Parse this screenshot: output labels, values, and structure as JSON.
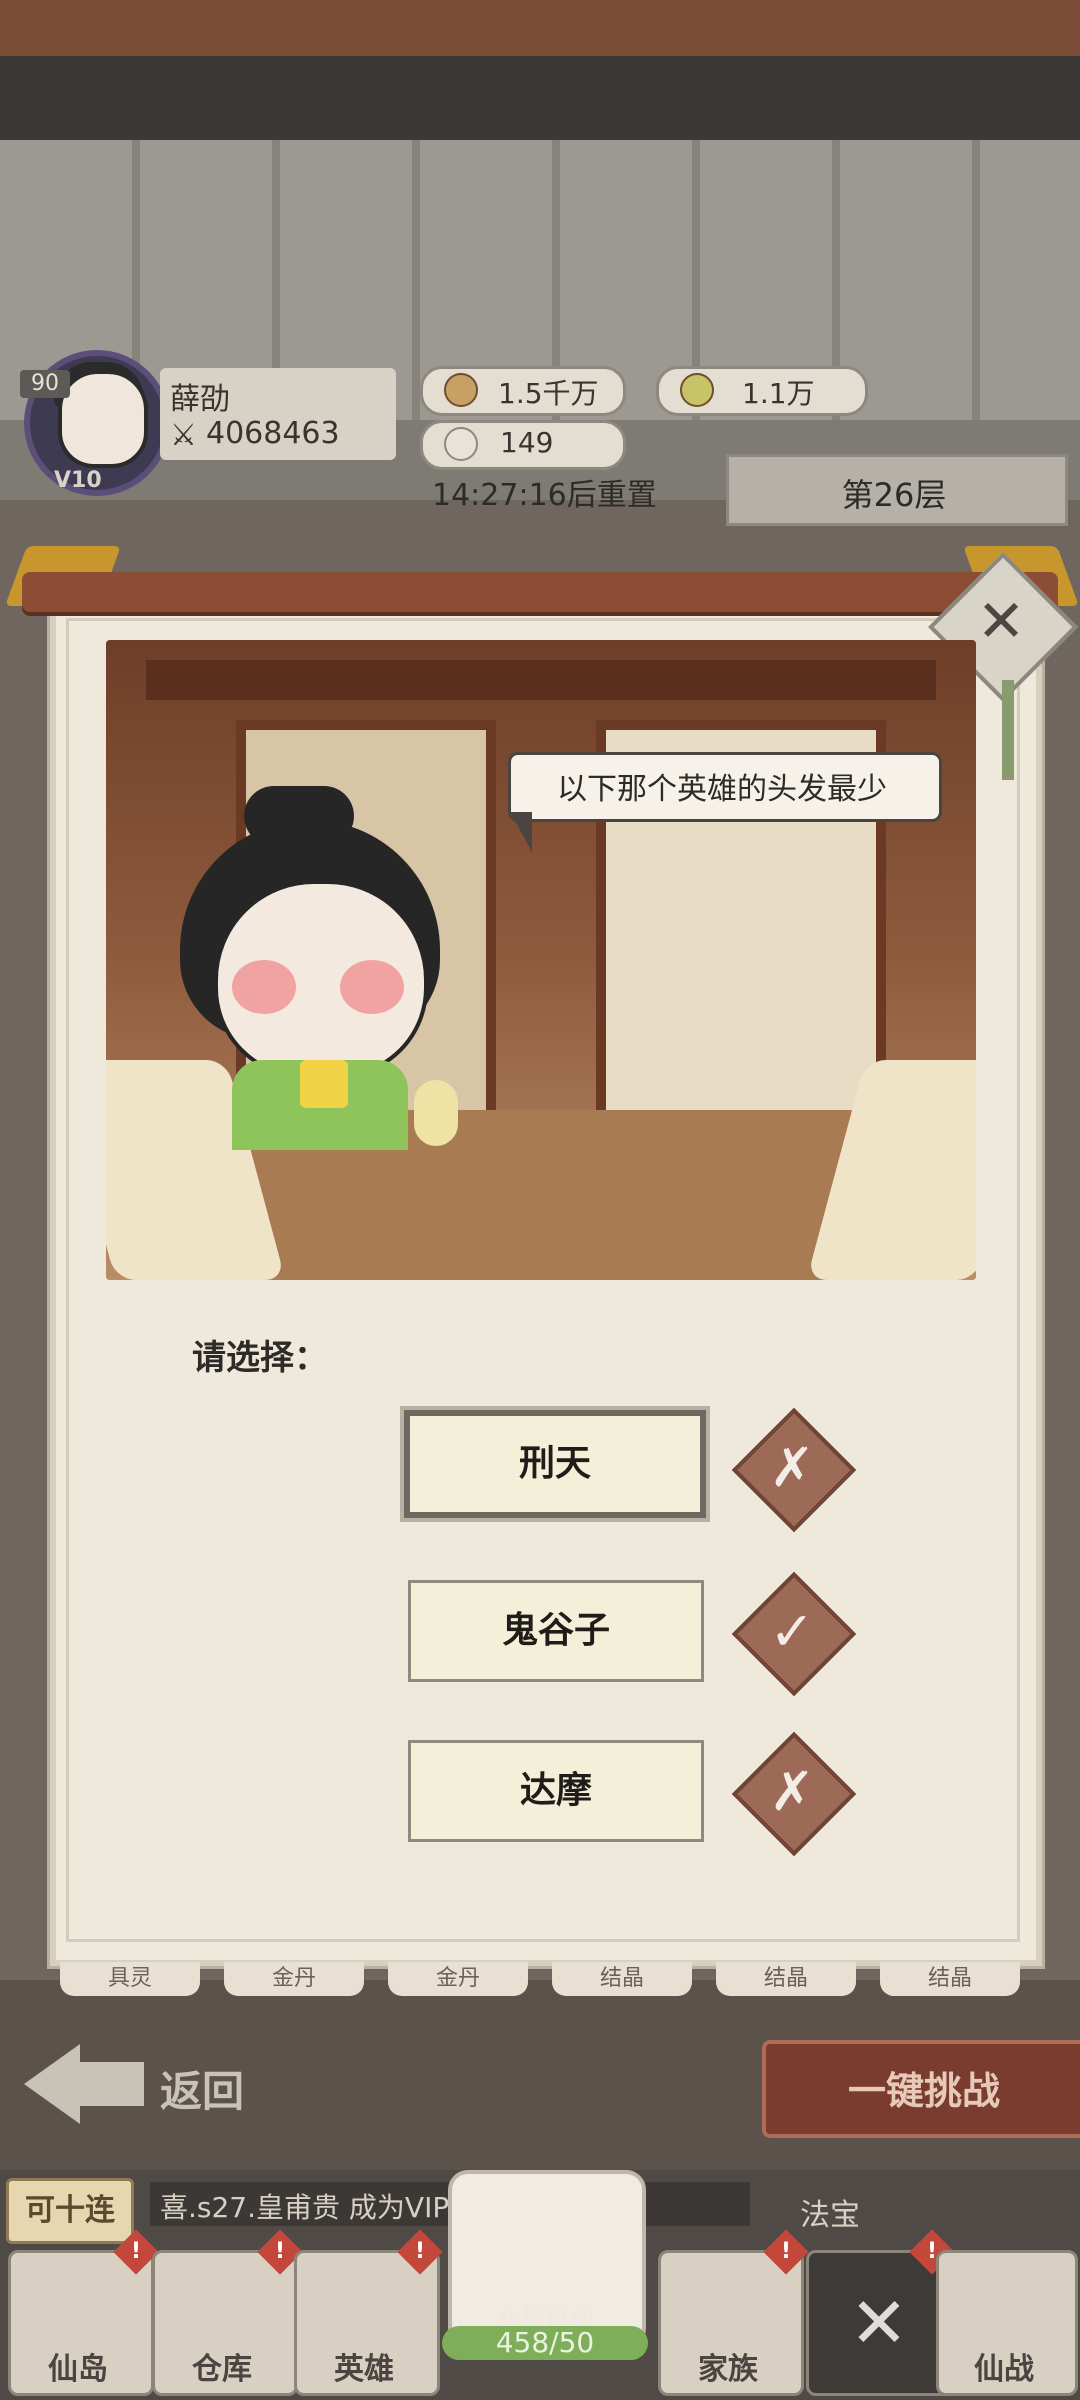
{
  "player": {
    "level": "90",
    "vip": "V10",
    "name": "薛劭",
    "power": "4068463"
  },
  "resources": {
    "copper": "1.5千万",
    "ingot": "1.1万",
    "tokens": "149"
  },
  "reset_timer": "14:27:16后重置",
  "floor": "第26层",
  "quiz": {
    "question": "以下那个英雄的头发最少",
    "prompt": "请选择：",
    "options": [
      {
        "label": "刑天",
        "mark": "✗",
        "selected": true
      },
      {
        "label": "鬼谷子",
        "mark": "✓",
        "selected": false
      },
      {
        "label": "达摩",
        "mark": "✗",
        "selected": false
      }
    ]
  },
  "rewards": [
    "具灵",
    "金丹",
    "金丹",
    "结晶",
    "结晶",
    "结晶"
  ],
  "actions": {
    "back": "返回",
    "auto_challenge": "一键挑战",
    "close": "✕"
  },
  "ticker": {
    "badge": "可十连",
    "text": "喜.s27.皇甫贵 成为VIP7"
  },
  "dice": {
    "label": "长按自动",
    "count": "458/50"
  },
  "fabao": "法宝",
  "nav": [
    "仙岛",
    "仓库",
    "英雄",
    "",
    "家族",
    "",
    "仙战"
  ]
}
